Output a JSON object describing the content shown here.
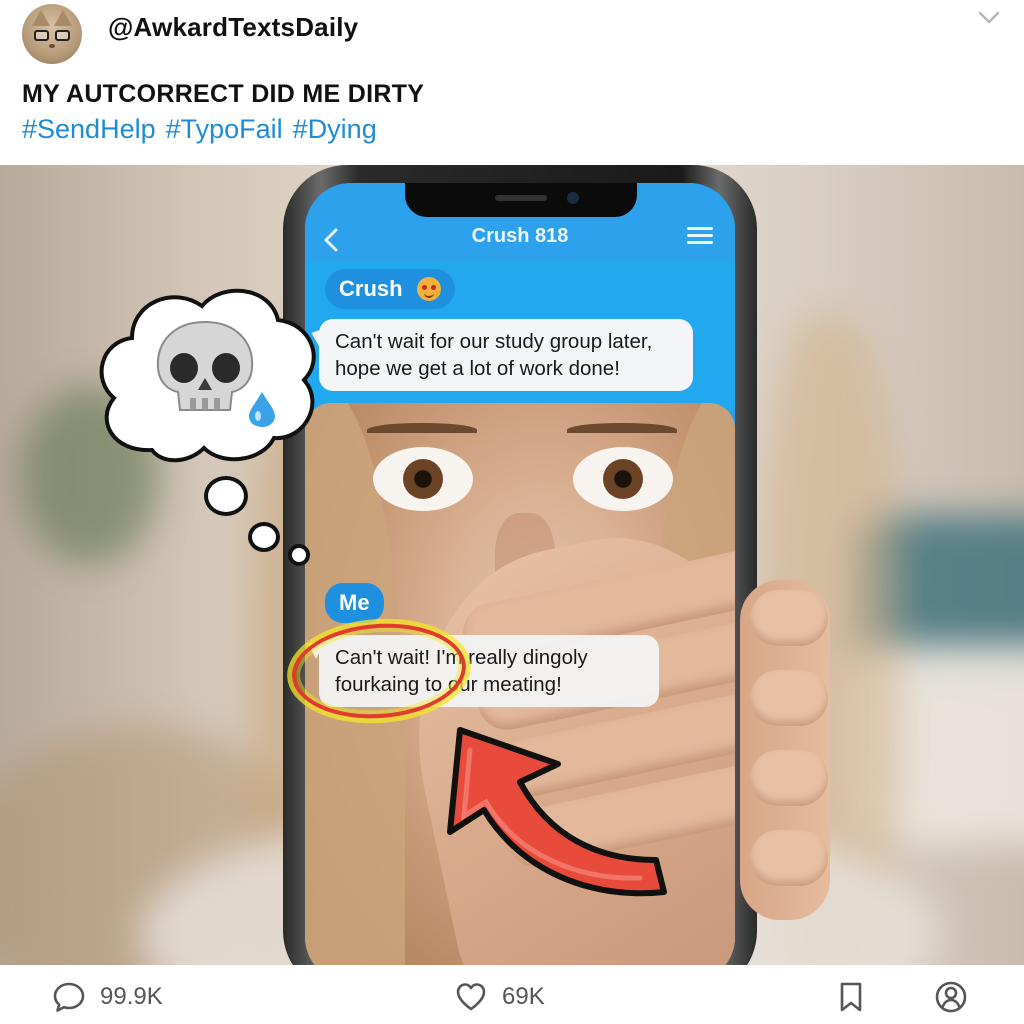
{
  "post": {
    "handle": "@AwkardTextsDaily",
    "title": "MY AUTCORRECT DID ME DIRTY",
    "hashtags": [
      "#SendHelp",
      "#TypoFail",
      "#Dying"
    ]
  },
  "chat": {
    "contact_name": "Crush 818",
    "crush_label": "Crush",
    "incoming_message_line1": "Can't wait for our study group later,",
    "incoming_message_line2": "hope we get a lot of work done!",
    "me_label": "Me",
    "outgoing_message_line1": "Can't wait! I'm really dingoly",
    "outgoing_message_line2": "fourkaing to our meating!"
  },
  "actions": {
    "replies": "99.9K",
    "likes": "69K"
  },
  "icons": [
    "chevron-down-icon",
    "back-icon",
    "menu-icon",
    "skull-icon",
    "sweat-drop-icon",
    "reply-icon",
    "heart-icon",
    "bookmark-icon",
    "profile-icon"
  ],
  "colors": {
    "hashtag": "#1d8bd6",
    "chat_header": "#2ea1ec",
    "pill": "#1f8fe0",
    "highlight_ring": "#e23b2b",
    "arrow": "#e84a3c"
  }
}
